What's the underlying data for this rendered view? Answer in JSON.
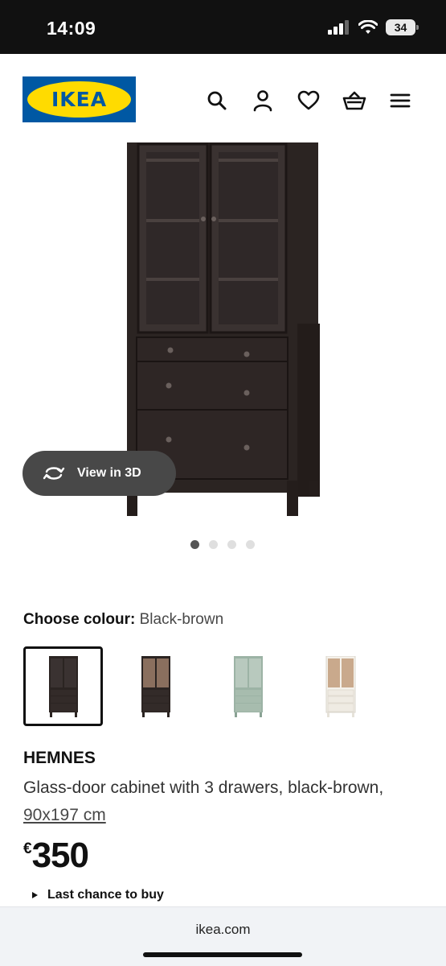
{
  "status_bar": {
    "time": "14:09",
    "battery": "34"
  },
  "header": {
    "logo_text": "IKEA",
    "icons": [
      "search-icon",
      "account-icon",
      "heart-icon",
      "basket-icon",
      "menu-icon"
    ]
  },
  "gallery": {
    "view_3d_label": "View in 3D",
    "dot_count": 4,
    "active_dot": 1
  },
  "colour": {
    "label": "Choose colour:",
    "value": "Black-brown",
    "swatches": [
      "Black-brown",
      "Black-brown/light brown glass",
      "Grey-green",
      "White"
    ]
  },
  "product": {
    "name": "HEMNES",
    "description": "Glass-door cabinet with 3 drawers, black-brown, ",
    "size": "90x197 cm",
    "currency": "€",
    "price": "350",
    "availability": "Last chance to buy"
  },
  "browser": {
    "url": "ikea.com"
  },
  "colors": {
    "ikea_blue": "#0058a3",
    "ikea_yellow": "#ffdb00",
    "cabinet_dark": "#2b2422",
    "cabinet_green": "#9cb3a5",
    "cabinet_white": "#f4f1ea"
  }
}
